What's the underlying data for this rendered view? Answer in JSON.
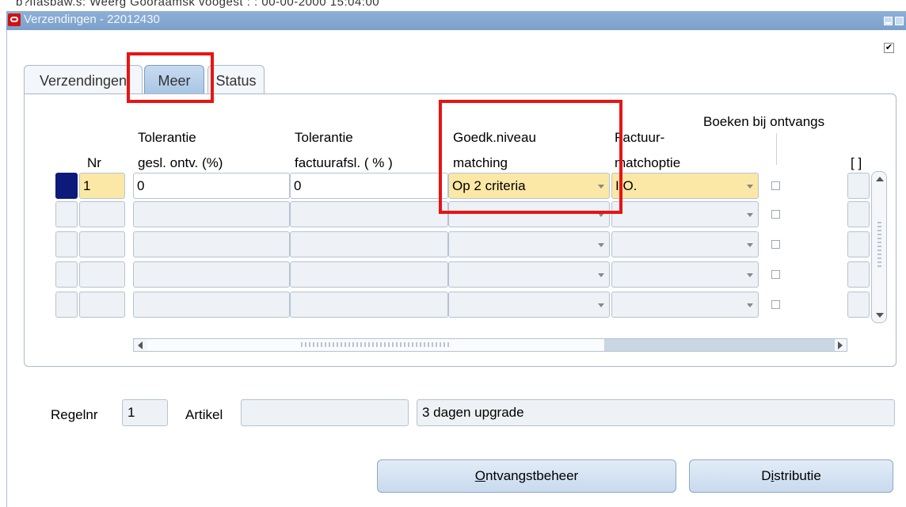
{
  "background_strip_text": "b?ifasbaw.s: Weerg Gooraamsk    voogest  : : 00-00-2000 15:04:00",
  "window": {
    "title": "Verzendingen - 22012430",
    "checkbox_mark": "✔"
  },
  "tabs": [
    {
      "label": "Verzendingen"
    },
    {
      "label": "Meer"
    },
    {
      "label": "Status"
    }
  ],
  "columns": {
    "nr": "Nr",
    "tol_ontv_line1": "Tolerantie",
    "tol_ontv_line2": "gesl. ontv. (%)",
    "tol_fact_line1": "Tolerantie",
    "tol_fact_line2": "factuurafsl. ( % )",
    "goedk_line1": "Goedk.niveau",
    "goedk_line2": "matching",
    "factuur_line1": "Factuur-",
    "factuur_line2": "matchoptie",
    "boeken": "Boeken bij ontvangs",
    "extra": "[ ]"
  },
  "rows": [
    {
      "nr": "1",
      "tol_ontv": "0",
      "tol_fact": "0",
      "goedk": "Op 2 criteria",
      "factuur": "I.O."
    },
    {
      "nr": "",
      "tol_ontv": "",
      "tol_fact": "",
      "goedk": "",
      "factuur": ""
    },
    {
      "nr": "",
      "tol_ontv": "",
      "tol_fact": "",
      "goedk": "",
      "factuur": ""
    },
    {
      "nr": "",
      "tol_ontv": "",
      "tol_fact": "",
      "goedk": "",
      "factuur": ""
    },
    {
      "nr": "",
      "tol_ontv": "",
      "tol_fact": "",
      "goedk": "",
      "factuur": ""
    }
  ],
  "bottom": {
    "regelnr_label": "Regelnr",
    "regelnr_value": "1",
    "artikel_label": "Artikel",
    "artikel_value": "",
    "description": "3 dagen upgrade"
  },
  "buttons": {
    "ontvangst_mnemonic": "O",
    "ontvangst_rest": "ntvangstbeheer",
    "distributie_pre": "D",
    "distributie_mnemonic": "i",
    "distributie_rest": "stributie"
  },
  "colors": {
    "title_bar": "#8fb0d6",
    "active_field": "#fbe8a6",
    "annotation": "#e81414"
  }
}
